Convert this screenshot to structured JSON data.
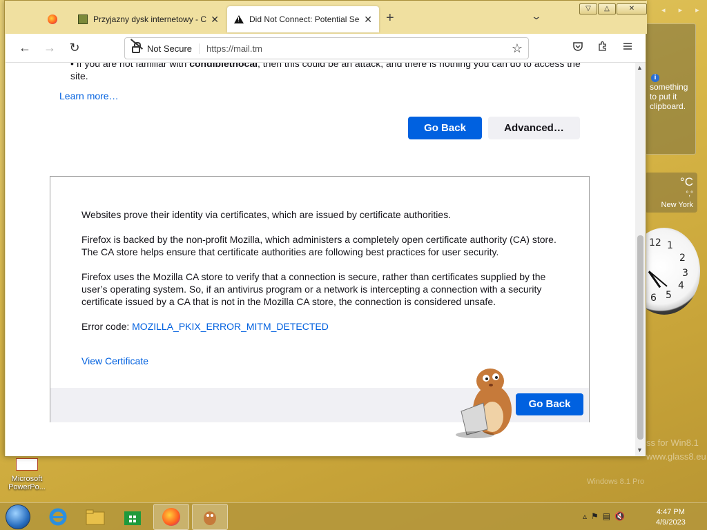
{
  "browser": {
    "tabs": [
      {
        "title": "Przyjazny dysk internetowy - Chomikuj.pl",
        "active": false
      },
      {
        "title": "Did Not Connect: Potential Security Issue",
        "active": true
      }
    ],
    "new_tab_symbol": "+",
    "tab_list_symbol": "⌄",
    "window_controls": {
      "minimize": "▽",
      "maximize": "△",
      "close": "✕"
    },
    "nav": {
      "back": "←",
      "forward": "→",
      "reload": "↻"
    },
    "url_bar": {
      "security_label": "Not Secure",
      "url": "https://mail.tm"
    },
    "toolbar_icons": [
      "pocket-icon",
      "extensions-icon",
      "menu-icon"
    ]
  },
  "page": {
    "partial_bullet": {
      "prefix": "If you are not familiar with ",
      "bold": "condibiethocal",
      "suffix": ", then this could be an attack, and there is nothing you can do to access the site."
    },
    "learn_more": "Learn more…",
    "go_back": "Go Back",
    "advanced": "Advanced…",
    "advanced_panel": {
      "para1": "Websites prove their identity via certificates, which are issued by certificate authorities.",
      "para2": "Firefox is backed by the non-profit Mozilla, which administers a completely open certificate authority (CA) store. The CA store helps ensure that certificate authorities are following best practices for user security.",
      "para3": "Firefox uses the Mozilla CA store to verify that a connection is secure, rather than certificates supplied by the user’s operating system. So, if an antivirus program or a network is intercepting a connection with a security certificate issued by a CA that is not in the Mozilla CA store, the connection is considered unsafe.",
      "error_code_label": "Error code: ",
      "error_code": "MOZILLA_PKIX_ERROR_MITM_DETECTED",
      "view_certificate": "View Certificate",
      "go_back": "Go Back"
    }
  },
  "desktop": {
    "gadget_text": "something to put it clipboard.",
    "weather": {
      "temp": "°C",
      "sub": "°,°",
      "city": "New York"
    },
    "clock_numbers": [
      "12",
      "1",
      "2",
      "3",
      "4",
      "5",
      "6"
    ],
    "watermark": "ss for Win8.1\nwww.glass8.eu",
    "watermark2": "Windows 8.1 Pro",
    "desktop_icon_label": "Microsoft PowerPo..."
  },
  "taskbar": {
    "time": "4:47 PM",
    "date": "4/9/2023"
  },
  "colors": {
    "primary_button": "#0061e0",
    "link": "#0060df"
  }
}
